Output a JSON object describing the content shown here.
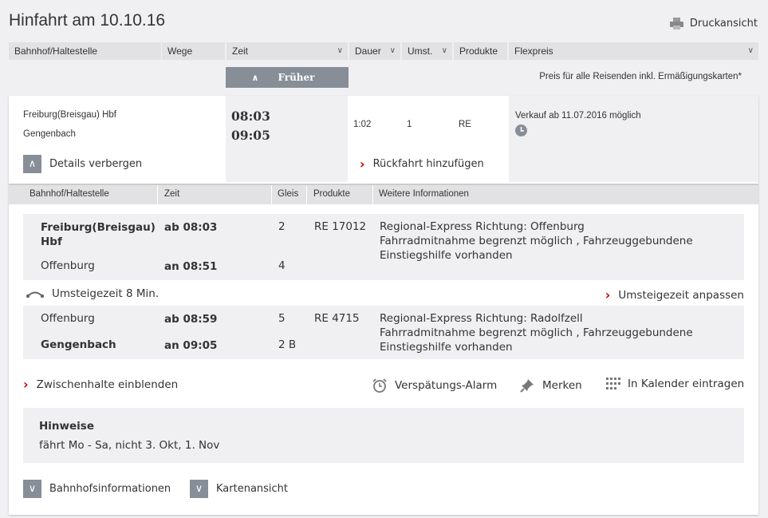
{
  "page": {
    "title": "Hinfahrt am 10.10.16",
    "print_label": "Druckansicht"
  },
  "columns": {
    "station": "Bahnhof/Haltestelle",
    "ways": "Wege",
    "time": "Zeit",
    "duration": "Dauer",
    "transfers": "Umst.",
    "products": "Produkte",
    "price": "Flexpreis"
  },
  "earlier_label": "Früher",
  "price_note": "Preis für alle Reisenden inkl. Ermäßigungskarten*",
  "connection": {
    "from": "Freiburg(Breisgau) Hbf",
    "to": "Gengenbach",
    "dep": "08:03",
    "arr": "09:05",
    "duration": "1:02",
    "transfers": "1",
    "product": "RE",
    "sale_info": "Verkauf ab 11.07.2016 möglich",
    "hide_details": "Details verbergen",
    "add_return": "Rückfahrt hinzufügen"
  },
  "detail_columns": {
    "station": "Bahnhof/Haltestelle",
    "time": "Zeit",
    "track": "Gleis",
    "products": "Produkte",
    "info": "Weitere Informationen"
  },
  "legs": [
    {
      "from": "Freiburg(Breisgau) Hbf",
      "dep": "ab 08:03",
      "dep_track": "2",
      "to": "Offenburg",
      "arr": "an 08:51",
      "arr_track": "4",
      "train": "RE 17012",
      "info1": "Regional-Express Richtung: Offenburg",
      "info2": "Fahrradmitnahme begrenzt möglich , Fahrzeuggebundene",
      "info3": "Einstiegshilfe vorhanden"
    },
    {
      "from": "Offenburg",
      "dep": "ab 08:59",
      "dep_track": "5",
      "to": "Gengenbach",
      "arr": "an 09:05",
      "arr_track": "2 B",
      "train": "RE 4715",
      "info1": "Regional-Express Richtung: Radolfzell",
      "info2": "Fahrradmitnahme begrenzt möglich , Fahrzeuggebundene",
      "info3": "Einstiegshilfe vorhanden"
    }
  ],
  "transfer": {
    "label": "Umsteigezeit 8 Min.",
    "adjust": "Umsteigezeit anpassen"
  },
  "actions": {
    "intermediate": "Zwischenhalte einblenden",
    "alarm": "Verspätungs-Alarm",
    "remember": "Merken",
    "calendar": "In Kalender eintragen"
  },
  "hints": {
    "title": "Hinweise",
    "text": "fährt Mo - Sa, nicht 3. Okt, 1. Nov"
  },
  "footer": {
    "station_info": "Bahnhofsinformationen",
    "map_view": "Kartenansicht"
  }
}
